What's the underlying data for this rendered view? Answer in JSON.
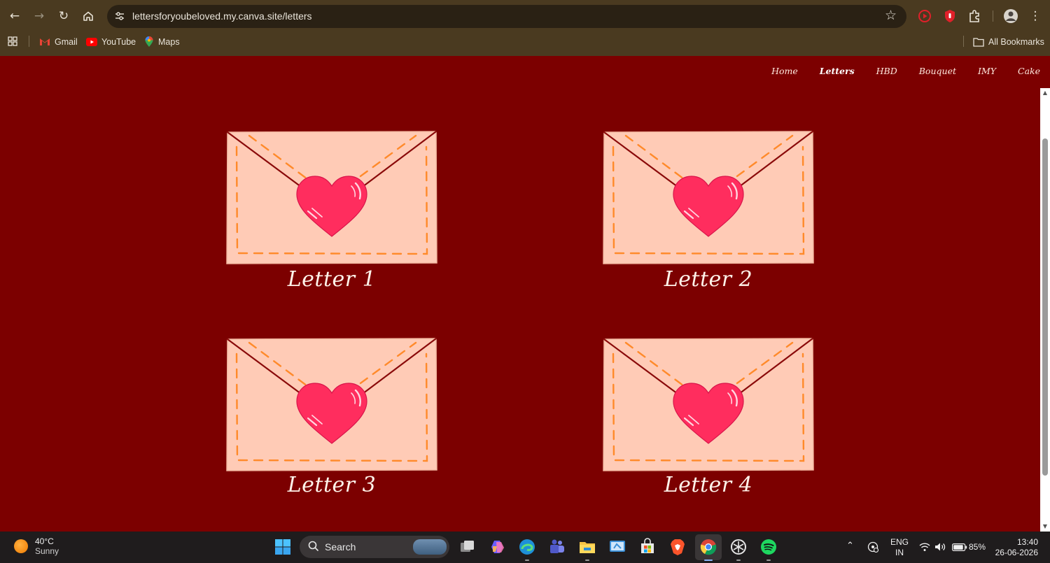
{
  "browser": {
    "url": "lettersforyoubeloved.my.canva.site/letters",
    "bookmarks": [
      {
        "label": "Gmail",
        "icon": "gmail-icon"
      },
      {
        "label": "YouTube",
        "icon": "youtube-icon"
      },
      {
        "label": "Maps",
        "icon": "maps-icon"
      }
    ],
    "all_bookmarks_label": "All Bookmarks"
  },
  "site": {
    "nav": [
      {
        "label": "Home",
        "active": false
      },
      {
        "label": "Letters",
        "active": true
      },
      {
        "label": "HBD",
        "active": false
      },
      {
        "label": "Bouquet",
        "active": false
      },
      {
        "label": "IMY",
        "active": false
      },
      {
        "label": "Cake",
        "active": false
      }
    ],
    "letters": [
      {
        "label": "Letter 1"
      },
      {
        "label": "Letter 2"
      },
      {
        "label": "Letter 3"
      },
      {
        "label": "Letter 4"
      }
    ],
    "colors": {
      "background": "#7c0000",
      "envelope": "#ffcbb6",
      "stitch": "#ff8a2a",
      "heart": "#ff2d5e",
      "flap_line": "#8a0a0a"
    }
  },
  "taskbar": {
    "weather_temp": "40°C",
    "weather_condition": "Sunny",
    "search_placeholder": "Search",
    "lang_top": "ENG",
    "lang_bottom": "IN",
    "battery": "85%",
    "time": "13:40",
    "date": "26-06-2026"
  }
}
